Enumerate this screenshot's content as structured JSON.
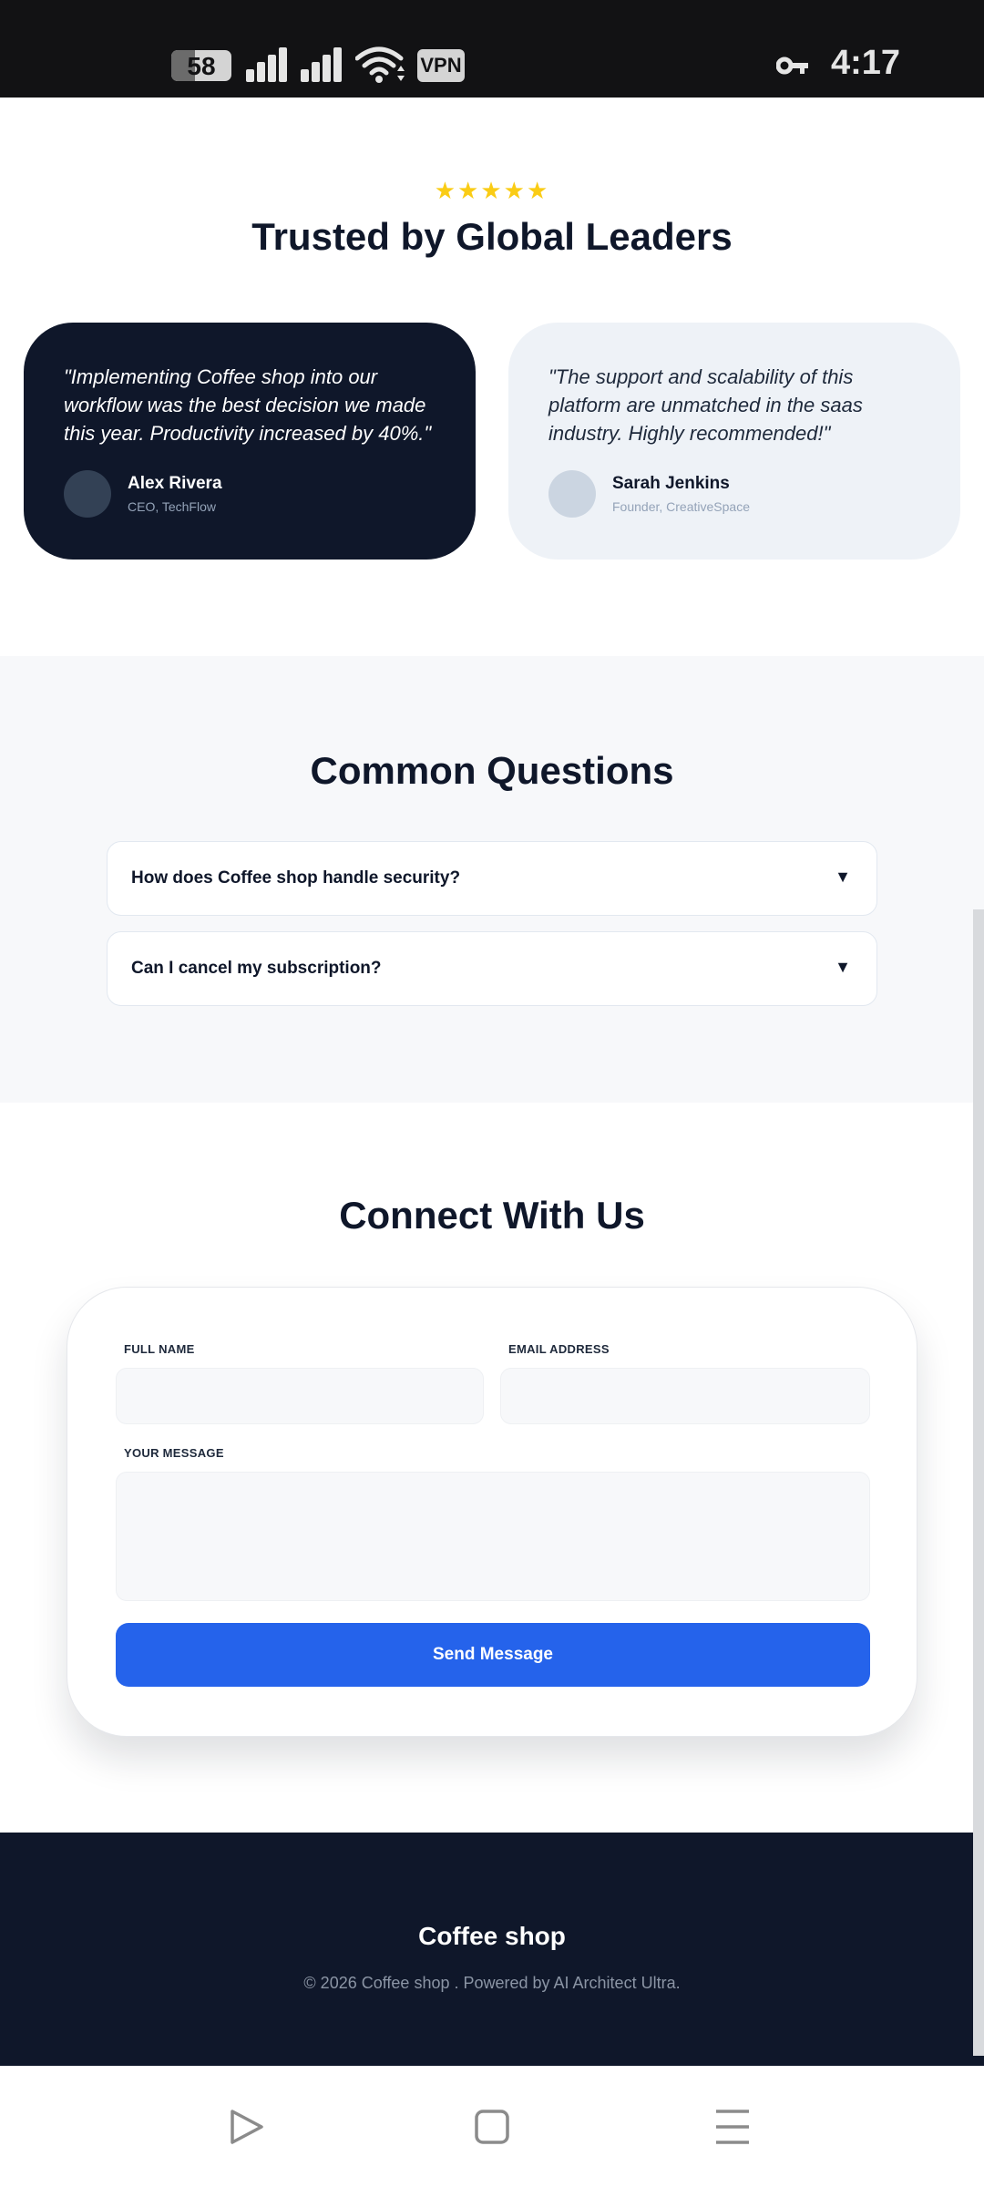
{
  "status_bar": {
    "battery": "58",
    "vpn": "VPN",
    "time": "4:17",
    "icons": [
      "battery-icon",
      "signal-icon",
      "signal-icon",
      "wifi-icon",
      "vpn-icon",
      "key-icon"
    ]
  },
  "testimonials": {
    "stars": "★★★★★",
    "rating": 5,
    "title": "Trusted by Global Leaders",
    "items": [
      {
        "quote": "\"Implementing Coffee shop into our workflow was the best decision we made this year. Productivity increased by 40%.\"",
        "name": "Alex Rivera",
        "role": "CEO, TechFlow"
      },
      {
        "quote": "\"The support and scalability of this platform are unmatched in the saas industry. Highly recommended!\"",
        "name": "Sarah Jenkins",
        "role": "Founder, CreativeSpace"
      }
    ]
  },
  "faq": {
    "title": "Common Questions",
    "items": [
      {
        "question": "How does Coffee shop handle security?",
        "arrow": "▼"
      },
      {
        "question": "Can I cancel my subscription?",
        "arrow": "▼"
      }
    ]
  },
  "contact": {
    "title": "Connect With Us",
    "full_name_label": "FULL NAME",
    "email_label": "EMAIL ADDRESS",
    "message_label": "YOUR MESSAGE",
    "full_name_value": "",
    "email_value": "",
    "message_value": "",
    "send_label": "Send Message"
  },
  "footer": {
    "brand": "Coffee shop",
    "copyright": "© 2026 Coffee shop . Powered by AI Architect Ultra."
  },
  "nav_bar": {
    "icons": [
      "back-triangle-icon",
      "home-square-icon",
      "menu-lines-icon"
    ]
  },
  "colors": {
    "dark_navy": "#0f172a",
    "accent_blue": "#2563eb",
    "star_yellow": "#facc15",
    "light_section": "#f7f8fa"
  }
}
